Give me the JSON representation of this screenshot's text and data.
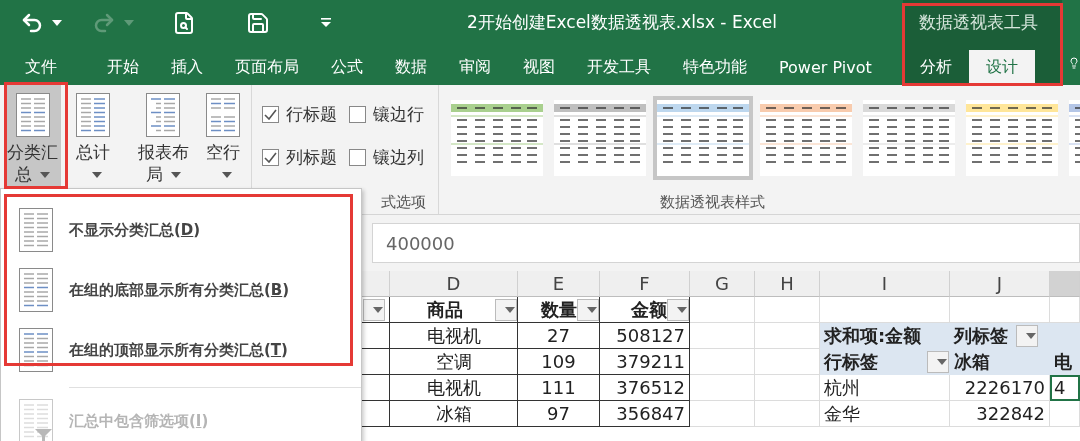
{
  "window": {
    "title": "2开始创建Excel数据透视表.xlsx - Excel"
  },
  "quick_access": [
    {
      "kind": "undo",
      "disabled": false
    },
    {
      "kind": "redo",
      "disabled": true
    },
    {
      "kind": "preview",
      "disabled": false
    },
    {
      "kind": "save",
      "disabled": false
    },
    {
      "kind": "customize",
      "disabled": false
    }
  ],
  "tabs": [
    {
      "label": "文件",
      "selected": false
    },
    {
      "label": "开始",
      "selected": false
    },
    {
      "label": "插入",
      "selected": false
    },
    {
      "label": "页面布局",
      "selected": false
    },
    {
      "label": "公式",
      "selected": false
    },
    {
      "label": "数据",
      "selected": false
    },
    {
      "label": "审阅",
      "selected": false
    },
    {
      "label": "视图",
      "selected": false
    },
    {
      "label": "开发工具",
      "selected": false
    },
    {
      "label": "特色功能",
      "selected": false
    },
    {
      "label": "Power Pivot",
      "selected": false
    }
  ],
  "contextual": {
    "title": "数据透视表工具",
    "tabs": [
      {
        "label": "分析",
        "selected": false
      },
      {
        "label": "设计",
        "selected": true
      }
    ]
  },
  "ribbon": {
    "layout_buttons": [
      {
        "label": "分类汇总",
        "kind": "subtotal",
        "pressed": true
      },
      {
        "label": "总计",
        "kind": "grand",
        "pressed": false
      },
      {
        "label": "报表布局",
        "kind": "layout",
        "pressed": false
      },
      {
        "label": "空行",
        "kind": "blank",
        "pressed": false
      }
    ],
    "options": [
      {
        "label": "行标题",
        "checked": true
      },
      {
        "label": "镶边行",
        "checked": false
      },
      {
        "label": "列标题",
        "checked": true
      },
      {
        "label": "镶边列",
        "checked": false
      }
    ],
    "options_group_label": "式选项",
    "styles": [
      {
        "color": "#a9d08e",
        "selected": false
      },
      {
        "color": "#bfbfbf",
        "selected": false
      },
      {
        "color": "#bdd7ee",
        "selected": true
      },
      {
        "color": "#f8cbad",
        "selected": false
      },
      {
        "color": "#d9d9d9",
        "selected": false
      },
      {
        "color": "#ffe699",
        "selected": false
      },
      {
        "color": "#b4c6e7",
        "selected": false
      }
    ],
    "styles_group_label": "数据透视表样式"
  },
  "formula_bar": {
    "value": "400000"
  },
  "sheet": {
    "columns": [
      {
        "label": "D",
        "selected": false
      },
      {
        "label": "E",
        "selected": false
      },
      {
        "label": "F",
        "selected": false
      },
      {
        "label": "G",
        "selected": false
      },
      {
        "label": "H",
        "selected": false
      },
      {
        "label": "I",
        "selected": false
      },
      {
        "label": "J",
        "selected": false
      },
      {
        "selected": true
      }
    ],
    "table": {
      "headers": [
        "商品",
        "数量",
        "金额"
      ],
      "rows": [
        [
          "电视机",
          "27",
          "508127"
        ],
        [
          "空调",
          "109",
          "379211"
        ],
        [
          "电视机",
          "111",
          "376512"
        ],
        [
          "冰箱",
          "97",
          "356847"
        ]
      ]
    },
    "pivot": {
      "value_field": "求和项:金额",
      "column_labels": "列标签",
      "row_labels": "行标签",
      "column_items": [
        "冰箱",
        "电"
      ],
      "rows": [
        {
          "label": "杭州",
          "values": [
            {
              "text": "2226170",
              "selected": false
            },
            {
              "text": "4",
              "selected": true
            }
          ]
        },
        {
          "label": "金华",
          "values": [
            {
              "text": "322842",
              "selected": false
            }
          ]
        }
      ]
    }
  },
  "menu": {
    "items": [
      {
        "kind": "none",
        "parts": [
          "不显示分类汇总(",
          "D",
          ")"
        ],
        "disabled": false
      },
      {
        "kind": "bottom",
        "parts": [
          "在组的底部显示所有分类汇总(",
          "B",
          ")"
        ],
        "disabled": false
      },
      {
        "kind": "top",
        "parts": [
          "在组的顶部显示所有分类汇总(",
          "T",
          ")"
        ],
        "disabled": false
      }
    ],
    "footer_items": [
      {
        "kind": "filter",
        "parts": [
          "汇总中包含筛选项(",
          "I",
          ")"
        ],
        "disabled": true
      }
    ]
  }
}
